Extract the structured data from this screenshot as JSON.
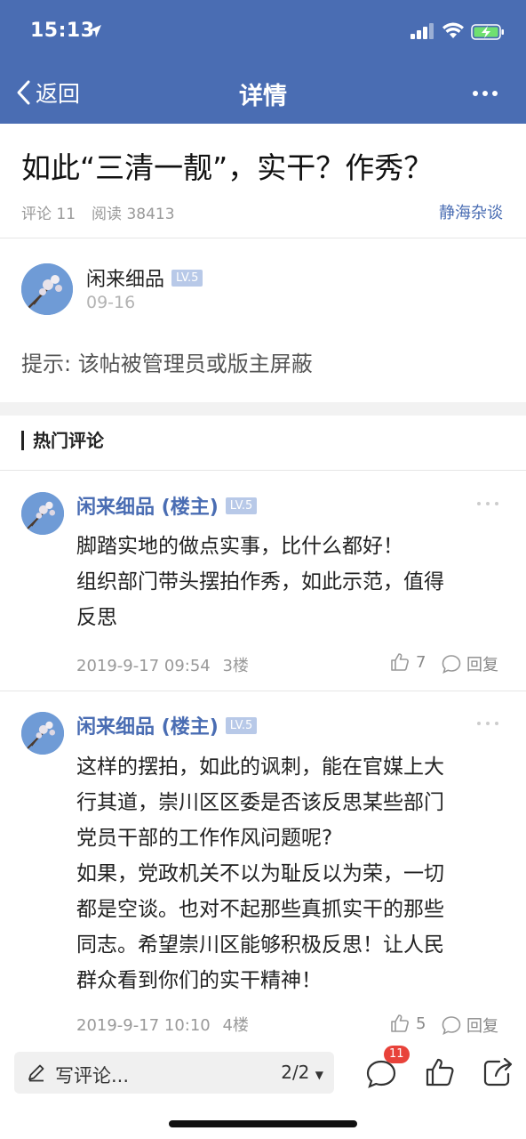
{
  "status": {
    "time": "15:13"
  },
  "nav": {
    "back_label": "返回",
    "title": "详情"
  },
  "article": {
    "title": "如此“三清一靓”，实干？作秀？",
    "comments_label": "评论 11",
    "reads_label": "阅读 38413",
    "board": "静海杂谈"
  },
  "post": {
    "author": "闲来细品",
    "level": "LV.5",
    "date": "09-16",
    "hint": "提示: 该帖被管理员或版主屏蔽"
  },
  "hot_comments": {
    "title": "热门评论",
    "items": [
      {
        "author": "闲来细品 (楼主)",
        "level": "LV.5",
        "lines": [
          "脚踏实地的做点实事，比什么都好！",
          "组织部门带头摆拍作秀，如此示范，值得",
          "反思"
        ],
        "time": "2019-9-17 09:54",
        "floor": "3楼",
        "likes": "7",
        "reply_label": "回复"
      },
      {
        "author": "闲来细品 (楼主)",
        "level": "LV.5",
        "lines": [
          "这样的摆拍，如此的讽刺，能在官媒上大",
          "行其道，崇川区区委是否该反思某些部门",
          "党员干部的工作作风问题呢?",
          "如果，党政机关不以为耻反以为荣，一切",
          "都是空谈。也对不起那些真抓实干的那些",
          "同志。希望崇川区能够积极反思！让人民",
          "群众看到你们的实干精神！"
        ],
        "time": "2019-9-17 10:10",
        "floor": "4楼",
        "likes": "5",
        "reply_label": "回复"
      }
    ]
  },
  "bottom": {
    "write_placeholder": "写评论...",
    "page_indicator": "2/2",
    "comment_count_badge": "11"
  },
  "colors": {
    "brand": "#4a6db3",
    "badge": "#e8423a",
    "level_tag": "#b8c9e8"
  }
}
